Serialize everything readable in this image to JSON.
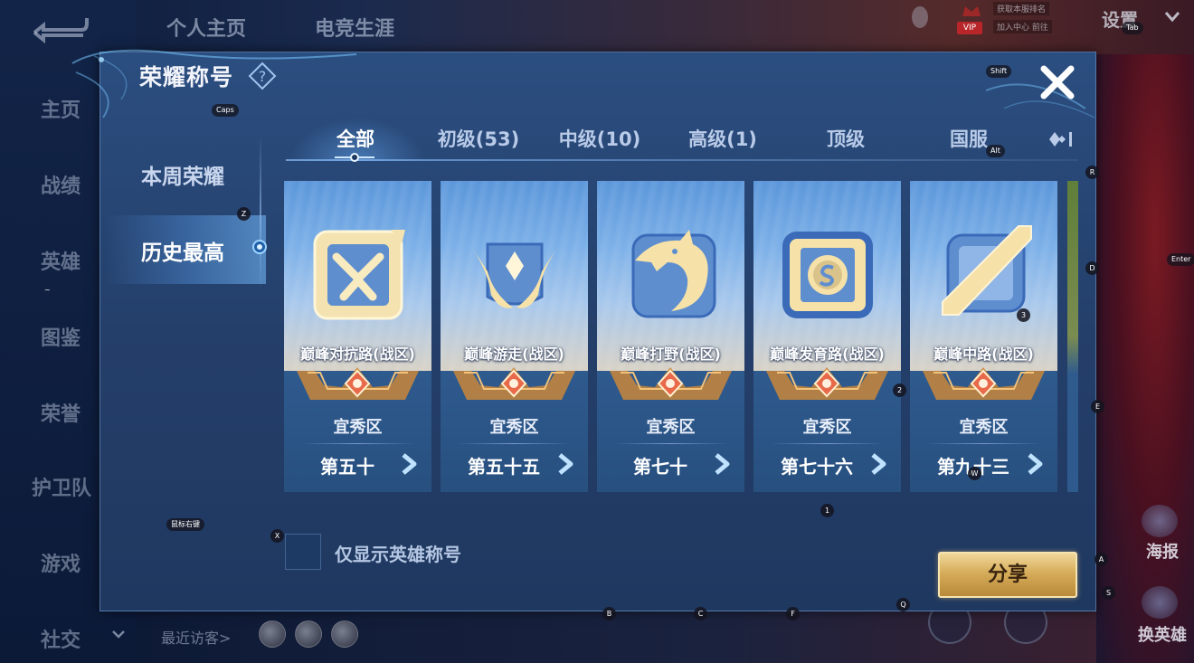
{
  "background": {
    "top_tabs": [
      "个人主页",
      "电竞生涯"
    ],
    "settings_label": "设置",
    "vip_label": "VIP",
    "top_small_texts": [
      "获取本服排名",
      "加入中心 前往"
    ],
    "side_nav": [
      "主页",
      "战绩",
      "英雄",
      "图鉴",
      "荣誉",
      "护卫队",
      "游戏",
      "社交"
    ],
    "recent_visitors_label": "最近访客>",
    "poster_label": "海报",
    "swap_hero_label": "换英雄"
  },
  "key_hints": {
    "tab": "Tab",
    "shift": "Shift",
    "caps": "Caps",
    "alt": "Alt",
    "enter": "Enter",
    "mouse_right": "鼠标右键",
    "z": "Z",
    "r": "R",
    "d": "D",
    "e": "E",
    "a": "A",
    "s": "S",
    "x": "X",
    "w": "W",
    "b": "B",
    "c": "C",
    "f": "F",
    "q": "Q",
    "one": "1",
    "two": "2",
    "three": "3",
    "tilde": "~"
  },
  "panel": {
    "title": "荣耀称号",
    "left_tabs": [
      {
        "label": "本周荣耀",
        "active": false
      },
      {
        "label": "历史最高",
        "active": true
      }
    ],
    "top_tabs": [
      {
        "label": "全部",
        "active": true
      },
      {
        "label": "初级(53)",
        "active": false
      },
      {
        "label": "中级(10)",
        "active": false
      },
      {
        "label": "高级(1)",
        "active": false
      },
      {
        "label": "顶级",
        "active": false
      },
      {
        "label": "国服",
        "active": false
      }
    ],
    "cards": [
      {
        "name": "巅峰对抗路(战区)",
        "region": "宜秀区",
        "rank": "第五十",
        "emblem": "crossed-swords-emblem"
      },
      {
        "name": "巅峰游走(战区)",
        "region": "宜秀区",
        "rank": "第五十五",
        "emblem": "winged-emblem"
      },
      {
        "name": "巅峰打野(战区)",
        "region": "宜秀区",
        "rank": "第七十",
        "emblem": "dragon-emblem"
      },
      {
        "name": "巅峰发育路(战区)",
        "region": "宜秀区",
        "rank": "第七十六",
        "emblem": "coin-emblem"
      },
      {
        "name": "巅峰中路(战区)",
        "region": "宜秀区",
        "rank": "第九十三",
        "emblem": "slash-emblem"
      }
    ],
    "hero_only_checkbox": {
      "label": "仅显示英雄称号",
      "checked": false
    },
    "share_label": "分享"
  },
  "colors": {
    "panel": "#2b4e80",
    "share_gold": "#d6ad5a",
    "card_sky": "#7cb0e8"
  }
}
